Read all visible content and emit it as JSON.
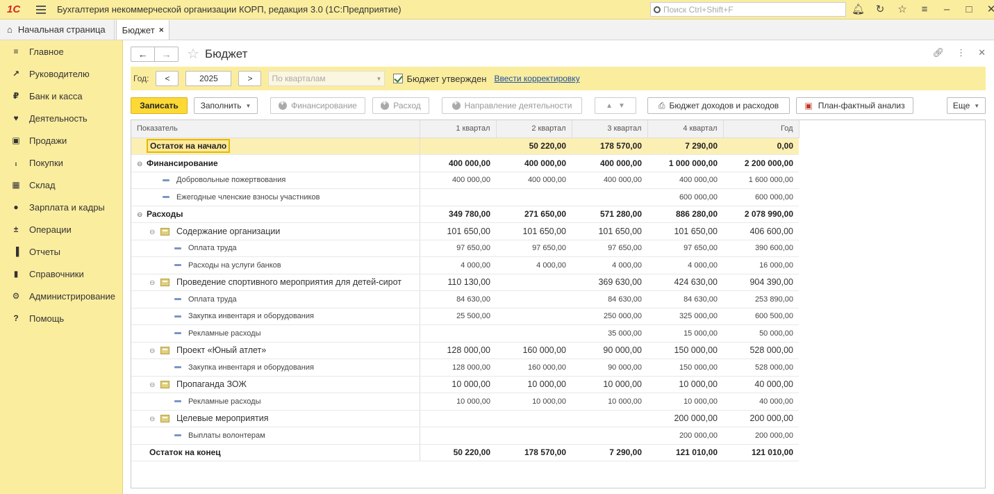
{
  "app": {
    "logo": "1С",
    "title": "Бухгалтерия некоммерческой организации КОРП, редакция 3.0  (1С:Предприятие)",
    "search_placeholder": "Поиск Ctrl+Shift+F"
  },
  "tabs": {
    "home": "Начальная страница",
    "active": "Бюджет"
  },
  "sidebar": [
    {
      "label": "Главное",
      "icon": "menu-icon"
    },
    {
      "label": "Руководителю",
      "icon": "chart-up-icon"
    },
    {
      "label": "Банк и касса",
      "icon": "ruble-icon"
    },
    {
      "label": "Деятельность",
      "icon": "activity-icon"
    },
    {
      "label": "Продажи",
      "icon": "bag-icon"
    },
    {
      "label": "Покупки",
      "icon": "cart-icon"
    },
    {
      "label": "Склад",
      "icon": "warehouse-icon"
    },
    {
      "label": "Зарплата и кадры",
      "icon": "person-icon"
    },
    {
      "label": "Операции",
      "icon": "dt-kt-icon"
    },
    {
      "label": "Отчеты",
      "icon": "bar-chart-icon"
    },
    {
      "label": "Справочники",
      "icon": "book-icon"
    },
    {
      "label": "Администрирование",
      "icon": "gear-icon"
    },
    {
      "label": "Помощь",
      "icon": "question-icon"
    }
  ],
  "form": {
    "title": "Бюджет",
    "year_label": "Год:",
    "prev": "<",
    "year": "2025",
    "next": ">",
    "period_placeholder": "По кварталам",
    "approved_label": "Бюджет утвержден",
    "approved": true,
    "correction_link": "Ввести корректировку"
  },
  "toolbar": {
    "save": "Записать",
    "fill": "Заполнить",
    "financing": "Финансирование",
    "expense": "Расход",
    "activity": "Направление деятельности",
    "budget_report": "Бюджет доходов и расходов",
    "plan_fact": "План-фактный анализ",
    "more": "Еще"
  },
  "table": {
    "headers": [
      "Показатель",
      "1 квартал",
      "2 квартал",
      "3 квартал",
      "4 квартал",
      "Год"
    ],
    "rows": [
      {
        "type": "opening",
        "label": "Остаток на начало",
        "v": [
          "",
          "50 220,00",
          "178 570,00",
          "7 290,00",
          "0,00"
        ]
      },
      {
        "type": "group0",
        "label": "Финансирование",
        "v": [
          "400 000,00",
          "400 000,00",
          "400 000,00",
          "1 000 000,00",
          "2 200 000,00"
        ]
      },
      {
        "type": "item1",
        "label": "Добровольные пожертвования",
        "v": [
          "400 000,00",
          "400 000,00",
          "400 000,00",
          "400 000,00",
          "1 600 000,00"
        ]
      },
      {
        "type": "item1",
        "label": "Ежегодные членские взносы участников",
        "v": [
          "",
          "",
          "",
          "600 000,00",
          "600 000,00"
        ]
      },
      {
        "type": "group0",
        "label": "Расходы",
        "v": [
          "349 780,00",
          "271 650,00",
          "571 280,00",
          "886 280,00",
          "2 078 990,00"
        ]
      },
      {
        "type": "group1",
        "label": "Содержание организации",
        "v": [
          "101 650,00",
          "101 650,00",
          "101 650,00",
          "101 650,00",
          "406 600,00"
        ]
      },
      {
        "type": "item2",
        "label": "Оплата труда",
        "v": [
          "97 650,00",
          "97 650,00",
          "97 650,00",
          "97 650,00",
          "390 600,00"
        ]
      },
      {
        "type": "item2",
        "label": "Расходы на услуги банков",
        "v": [
          "4 000,00",
          "4 000,00",
          "4 000,00",
          "4 000,00",
          "16 000,00"
        ]
      },
      {
        "type": "group1",
        "label": "Проведение спортивного мероприятия для детей-сирот",
        "v": [
          "110 130,00",
          "",
          "369 630,00",
          "424 630,00",
          "904 390,00"
        ]
      },
      {
        "type": "item2",
        "label": "Оплата труда",
        "v": [
          "84 630,00",
          "",
          "84 630,00",
          "84 630,00",
          "253 890,00"
        ]
      },
      {
        "type": "item2",
        "label": "Закупка инвентаря и оборудования",
        "v": [
          "25 500,00",
          "",
          "250 000,00",
          "325 000,00",
          "600 500,00"
        ]
      },
      {
        "type": "item2",
        "label": "Рекламные расходы",
        "v": [
          "",
          "",
          "35 000,00",
          "15 000,00",
          "50 000,00"
        ]
      },
      {
        "type": "group1",
        "label": "Проект «Юный атлет»",
        "v": [
          "128 000,00",
          "160 000,00",
          "90 000,00",
          "150 000,00",
          "528 000,00"
        ]
      },
      {
        "type": "item2",
        "label": "Закупка инвентаря и оборудования",
        "v": [
          "128 000,00",
          "160 000,00",
          "90 000,00",
          "150 000,00",
          "528 000,00"
        ]
      },
      {
        "type": "group1",
        "label": "Пропаганда ЗОЖ",
        "v": [
          "10 000,00",
          "10 000,00",
          "10 000,00",
          "10 000,00",
          "40 000,00"
        ]
      },
      {
        "type": "item2",
        "label": "Рекламные расходы",
        "v": [
          "10 000,00",
          "10 000,00",
          "10 000,00",
          "10 000,00",
          "40 000,00"
        ]
      },
      {
        "type": "group1",
        "label": "Целевые мероприятия",
        "v": [
          "",
          "",
          "",
          "200 000,00",
          "200 000,00"
        ]
      },
      {
        "type": "item2",
        "label": "Выплаты волонтерам",
        "v": [
          "",
          "",
          "",
          "200 000,00",
          "200 000,00"
        ]
      },
      {
        "type": "closing",
        "label": "Остаток на конец",
        "v": [
          "50 220,00",
          "178 570,00",
          "7 290,00",
          "121 010,00",
          "121 010,00"
        ]
      }
    ]
  },
  "colors": {
    "accent": "#fbed9e",
    "primary_button": "#fdd935",
    "link": "#1c4fa5"
  }
}
